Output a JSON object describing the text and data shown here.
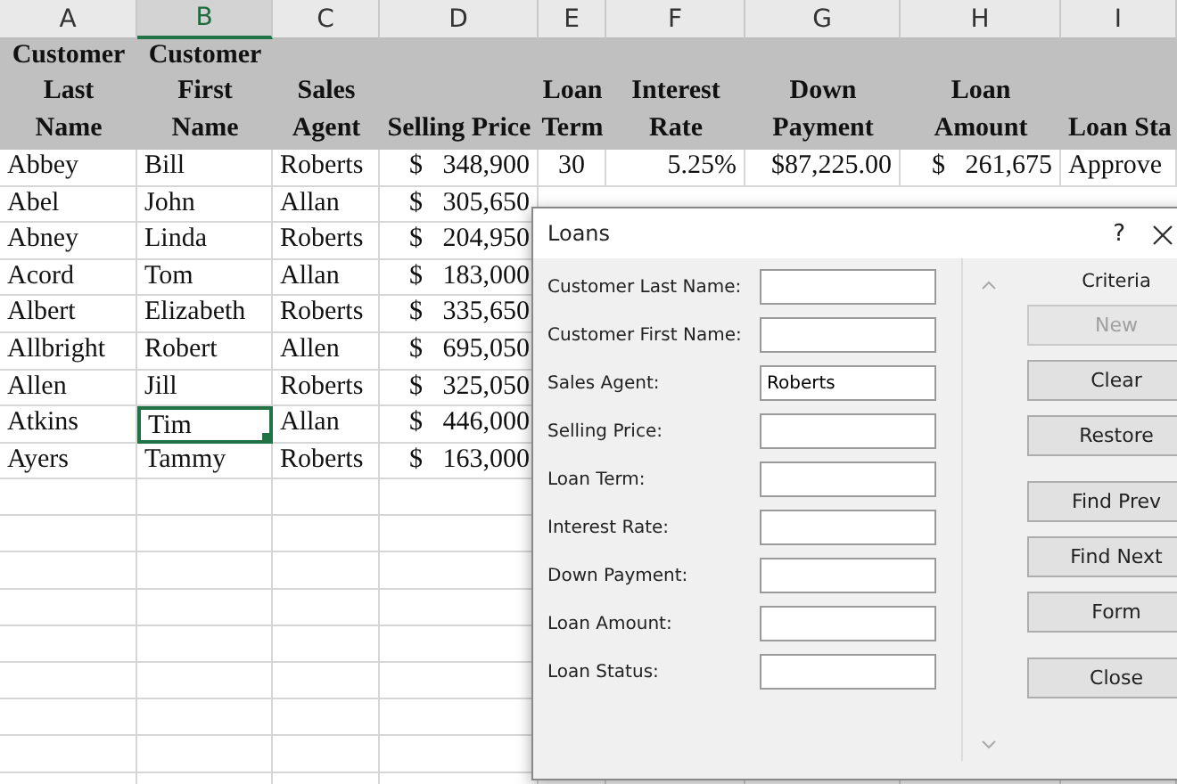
{
  "sheet": {
    "columns": [
      {
        "letter": "A",
        "selected": false,
        "header": [
          "Customer",
          "Last",
          "Name"
        ]
      },
      {
        "letter": "B",
        "selected": true,
        "header": [
          "Customer",
          "First",
          "Name"
        ]
      },
      {
        "letter": "C",
        "selected": false,
        "header": [
          "Sales",
          "Agent"
        ]
      },
      {
        "letter": "D",
        "selected": false,
        "header": [
          "Selling Price"
        ]
      },
      {
        "letter": "E",
        "selected": false,
        "header": [
          "Loan",
          "Term"
        ]
      },
      {
        "letter": "F",
        "selected": false,
        "header": [
          "Interest",
          "Rate"
        ]
      },
      {
        "letter": "G",
        "selected": false,
        "header": [
          "Down",
          "Payment"
        ]
      },
      {
        "letter": "H",
        "selected": false,
        "header": [
          "Loan",
          "Amount"
        ]
      },
      {
        "letter": "I",
        "selected": false,
        "header": [
          "Loan Sta"
        ]
      }
    ],
    "rows": [
      {
        "selected": false,
        "cells": [
          "Abbey",
          "Bill",
          "Roberts",
          "$   348,900",
          "30",
          "5.25%",
          "$87,225.00",
          "$   261,675",
          "Approve"
        ]
      },
      {
        "selected": false,
        "cells": [
          "Abel",
          "John",
          "Allan",
          "$   305,650"
        ]
      },
      {
        "selected": false,
        "cells": [
          "Abney",
          "Linda",
          "Roberts",
          "$   204,950"
        ]
      },
      {
        "selected": false,
        "cells": [
          "Acord",
          "Tom",
          "Allan",
          "$   183,000"
        ]
      },
      {
        "selected": false,
        "cells": [
          "Albert",
          "Elizabeth",
          "Roberts",
          "$   335,650"
        ]
      },
      {
        "selected": false,
        "cells": [
          "Allbright",
          "Robert",
          "Allen",
          "$   695,050"
        ]
      },
      {
        "selected": false,
        "cells": [
          "Allen",
          "Jill",
          "Roberts",
          "$   325,050"
        ]
      },
      {
        "selected": true,
        "cells": [
          "Atkins",
          "Tim",
          "Allan",
          "$   446,000"
        ]
      },
      {
        "selected": false,
        "cells": [
          "Ayers",
          "Tammy",
          "Roberts",
          "$   163,000"
        ]
      }
    ]
  },
  "dialog": {
    "title": "Loans",
    "help": "?",
    "mode": "Criteria",
    "fields": [
      {
        "label": "Customer Last Name:"
      },
      {
        "label": "Customer First Name:"
      },
      {
        "label": "Sales Agent:",
        "value": "Roberts"
      },
      {
        "label": "Selling Price:"
      },
      {
        "label": "Loan Term:"
      },
      {
        "label": "Interest Rate:"
      },
      {
        "label": "Down Payment:"
      },
      {
        "label": "Loan Amount:"
      },
      {
        "label": "Loan Status:"
      }
    ],
    "button_groups": [
      [
        {
          "label": "New",
          "disabled": true
        },
        {
          "label": "Clear",
          "disabled": false
        },
        {
          "label": "Restore",
          "disabled": false
        }
      ],
      [
        {
          "label": "Find Prev",
          "disabled": false
        },
        {
          "label": "Find Next",
          "disabled": false
        },
        {
          "label": "Form",
          "disabled": false
        }
      ],
      [
        {
          "label": "Close",
          "disabled": false
        }
      ]
    ]
  }
}
